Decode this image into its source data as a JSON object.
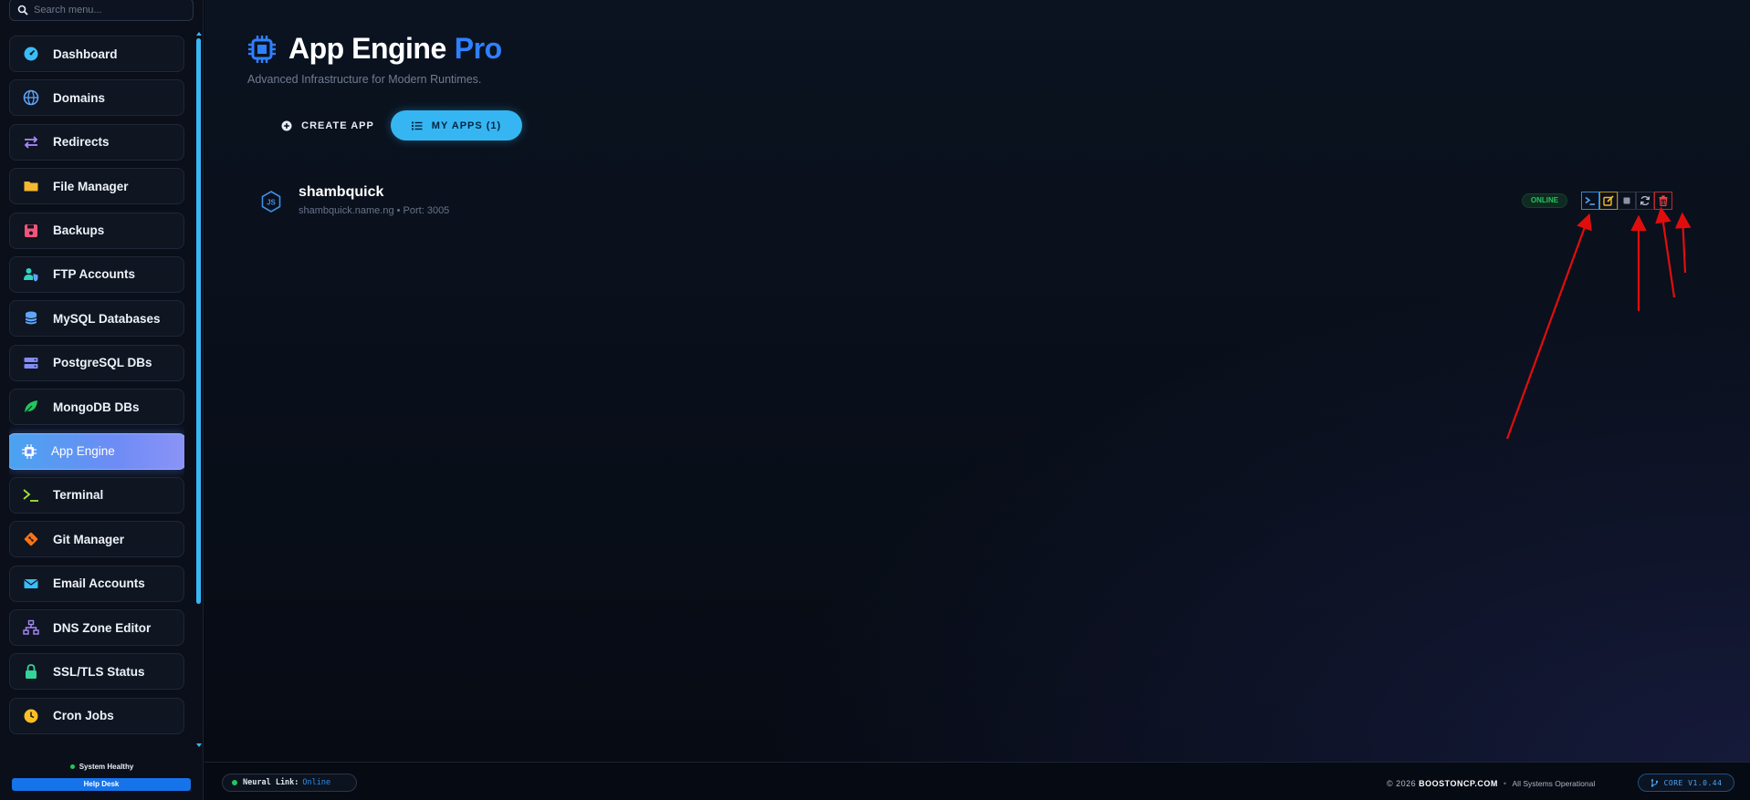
{
  "sidebar": {
    "search_placeholder": "Search menu...",
    "items": [
      {
        "label": "Dashboard",
        "icon": "gauge-icon",
        "color": "#38bdf8"
      },
      {
        "label": "Domains",
        "icon": "globe-icon",
        "color": "#60a5fa"
      },
      {
        "label": "Redirects",
        "icon": "arrows-exchange-icon",
        "color": "#a78bfa"
      },
      {
        "label": "File Manager",
        "icon": "folder-icon",
        "color": "#f5b82e"
      },
      {
        "label": "Backups",
        "icon": "floppy-disk-icon",
        "color": "#f2557a"
      },
      {
        "label": "FTP Accounts",
        "icon": "user-shield-icon",
        "color": "#2dd4bf"
      },
      {
        "label": "MySQL Databases",
        "icon": "database-icon",
        "color": "#60a5fa"
      },
      {
        "label": "PostgreSQL DBs",
        "icon": "server-icon",
        "color": "#818cf8"
      },
      {
        "label": "MongoDB DBs",
        "icon": "leaf-icon",
        "color": "#22c55e"
      },
      {
        "label": "App Engine",
        "icon": "microchip-icon",
        "color": "#ffffff",
        "active": true
      },
      {
        "label": "Terminal",
        "icon": "terminal-icon",
        "color": "#a3e635"
      },
      {
        "label": "Git Manager",
        "icon": "git-icon",
        "color": "#f97316"
      },
      {
        "label": "Email Accounts",
        "icon": "envelope-icon",
        "color": "#38bdf8"
      },
      {
        "label": "DNS Zone Editor",
        "icon": "sitemap-icon",
        "color": "#a78bfa"
      },
      {
        "label": "SSL/TLS Status",
        "icon": "lock-icon",
        "color": "#34d399"
      },
      {
        "label": "Cron Jobs",
        "icon": "clock-icon",
        "color": "#fbbf24"
      }
    ],
    "health_text": "System Healthy",
    "help_label": "Help Desk"
  },
  "header": {
    "title": "App Engine",
    "title_accent": "Pro",
    "subtitle": "Advanced Infrastructure for Modern Runtimes.",
    "icon": "microchip-icon"
  },
  "tabs": {
    "create_label": "CREATE APP",
    "apps_label": "MY APPS (1)"
  },
  "apps": [
    {
      "name": "shambquick",
      "domain": "shambquick.name.ng",
      "separator": "•",
      "port_label": "Port: 3005",
      "status": "ONLINE",
      "icon": "nodejs-icon"
    }
  ],
  "footer": {
    "neural_label": "Neural Link:",
    "neural_status": "Online",
    "copyright": "© 2026",
    "brand": "BOOSTONCP.COM",
    "separator": "•",
    "ops_status": "All Systems Operational",
    "version": "CORE V1.0.44"
  },
  "colors": {
    "accent": "#2f80ff",
    "tab_active": "#35b6f3",
    "online": "#22c55e",
    "annotation_arrow": "#e10d0d"
  }
}
